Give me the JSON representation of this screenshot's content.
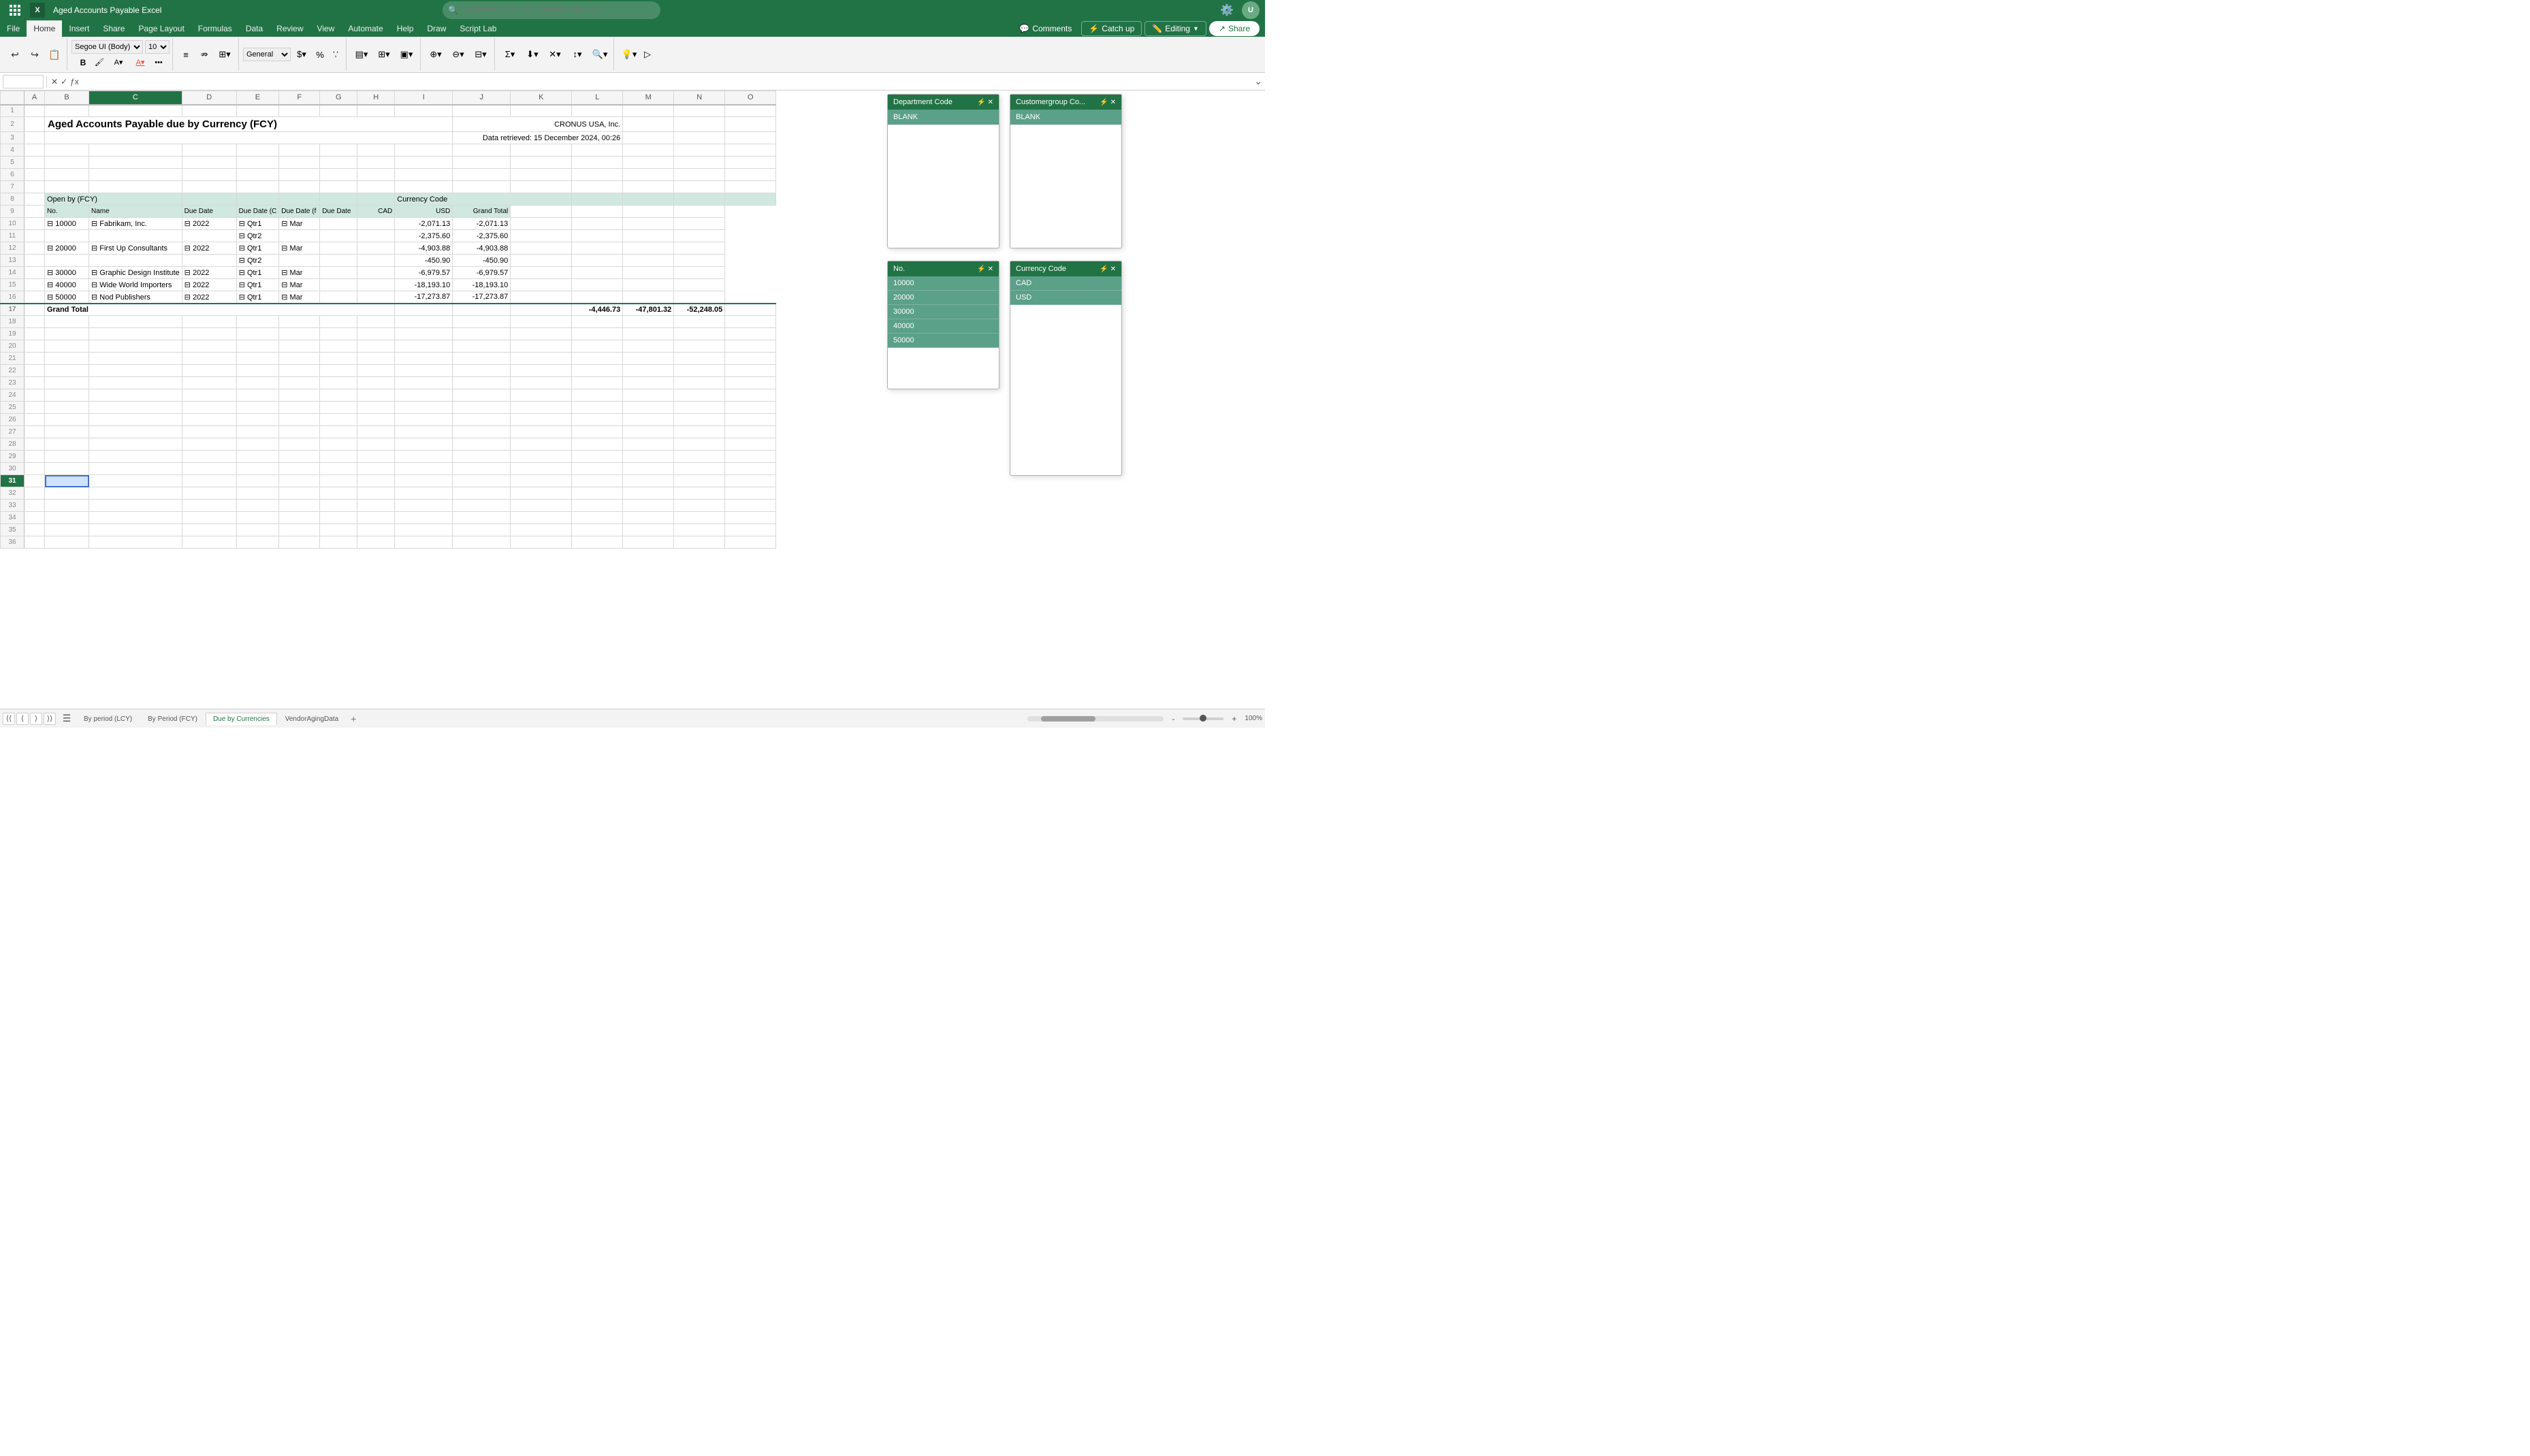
{
  "app": {
    "title": "Aged Accounts Payable Excel",
    "logo_text": "X"
  },
  "search": {
    "placeholder": "Search for tools, help, and more (Alt + Q)"
  },
  "ribbon": {
    "tabs": [
      "File",
      "Home",
      "Insert",
      "Share",
      "Page Layout",
      "Formulas",
      "Data",
      "Review",
      "View",
      "Automate",
      "Help",
      "Draw",
      "Script Lab"
    ],
    "active_tab": "Home",
    "font_name": "Segoe UI (Body)",
    "font_size": "10"
  },
  "action_buttons": {
    "comments": "Comments",
    "catchup": "Catch up",
    "editing": "Editing",
    "share": "Share"
  },
  "formula_bar": {
    "cell_ref": "C31",
    "content": ""
  },
  "spreadsheet": {
    "title": "Aged Accounts Payable due by Currency (FCY)",
    "subtitle1": "CRONUS USA, Inc.",
    "subtitle2": "Data retrieved: 15 December 2024, 00:26",
    "columns": {
      "row_num": "",
      "A": "A",
      "B": "B",
      "C": "C",
      "D": "D",
      "E": "E",
      "F": "F",
      "G": "G",
      "H": "H",
      "I": "I",
      "J": "J",
      "K": "K",
      "L": "L",
      "M": "M",
      "N": "N",
      "O": "O"
    },
    "pivot_headers": {
      "open_by": "Open by (FCY)",
      "currency_code": "Currency Code",
      "no": "No.",
      "name": "Name",
      "due_date": "Due Date",
      "due_date_c": "Due Date (C",
      "due_date_f": "Due Date (f",
      "due_date2": "Due Date",
      "cad": "CAD",
      "usd": "USD",
      "grand_total": "Grand Total"
    },
    "data_rows": [
      {
        "no": "10000",
        "name": "Fabrikam, Inc.",
        "year": "2022",
        "qtr": "Qtr1",
        "month": "Mar",
        "cad": "",
        "usd": "-2,071.13",
        "total": "-2,071.13"
      },
      {
        "no": "",
        "name": "",
        "year": "",
        "qtr": "Qtr2",
        "month": "",
        "cad": "",
        "usd": "-2,375.60",
        "total": "-2,375.60"
      },
      {
        "no": "20000",
        "name": "First Up Consultants",
        "year": "2022",
        "qtr": "Qtr1",
        "month": "Mar",
        "cad": "",
        "usd": "-4,903.88",
        "total": "-4,903.88"
      },
      {
        "no": "",
        "name": "",
        "year": "",
        "qtr": "Qtr2",
        "month": "",
        "cad": "",
        "usd": "-450.90",
        "total": "-450.90"
      },
      {
        "no": "30000",
        "name": "Graphic Design Institute",
        "year": "2022",
        "qtr": "Qtr1",
        "month": "Mar",
        "cad": "",
        "usd": "-6,979.57",
        "total": "-6,979.57"
      },
      {
        "no": "40000",
        "name": "Wide World Importers",
        "year": "2022",
        "qtr": "Qtr1",
        "month": "Mar",
        "cad": "",
        "usd": "-18,193.10",
        "total": "-18,193.10"
      },
      {
        "no": "50000",
        "name": "Nod Publishers",
        "year": "2022",
        "qtr": "Qtr1",
        "month": "Mar",
        "cad": "",
        "usd": "-17,273.87",
        "total": "-17,273.87"
      }
    ],
    "grand_total": {
      "label": "Grand Total",
      "cad": "-4,446.73",
      "usd": "-47,801.32",
      "total": "-52,248.05"
    }
  },
  "slicers": {
    "department_code": {
      "title": "Department Code",
      "items": [
        {
          "label": "BLANK",
          "active": true
        }
      ]
    },
    "customergroup": {
      "title": "Customergroup Co...",
      "items": [
        {
          "label": "BLANK",
          "active": true
        }
      ]
    },
    "no_slicer": {
      "title": "No.",
      "items": [
        {
          "label": "10000",
          "active": true
        },
        {
          "label": "20000",
          "active": true
        },
        {
          "label": "30000",
          "active": true
        },
        {
          "label": "40000",
          "active": true
        },
        {
          "label": "50000",
          "active": true
        }
      ]
    },
    "currency_code": {
      "title": "Currency Code",
      "items": [
        {
          "label": "CAD",
          "active": true
        },
        {
          "label": "USD",
          "active": true
        }
      ]
    }
  },
  "sheet_tabs": [
    {
      "label": "By period (LCY)",
      "active": false
    },
    {
      "label": "By Period (FCY)",
      "active": false
    },
    {
      "label": "Due by Currencies",
      "active": true
    },
    {
      "label": "VendorAgingData",
      "active": false
    }
  ],
  "status_bar": {
    "zoom": "100%"
  }
}
